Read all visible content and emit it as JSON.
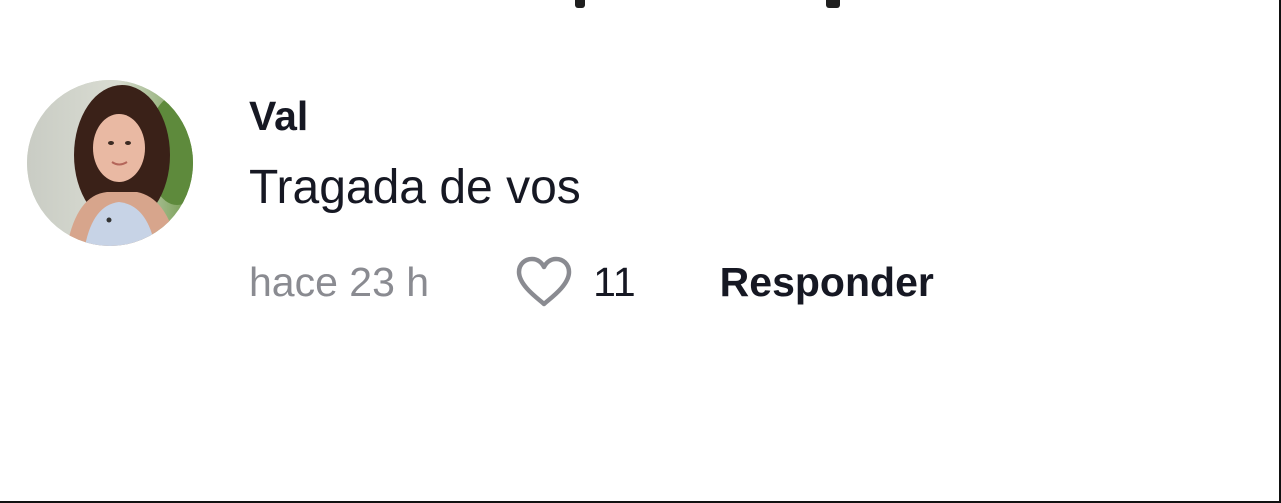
{
  "comment": {
    "username": "Val",
    "text": "Tragada de vos",
    "timestamp": "hace 23 h",
    "like_count": "11",
    "reply_label": "Responder",
    "like_icon": "heart-outline-icon"
  },
  "colors": {
    "text_primary": "#161823",
    "text_secondary": "#8a8b91",
    "icon_stroke": "#8a8b91",
    "background": "#ffffff"
  }
}
